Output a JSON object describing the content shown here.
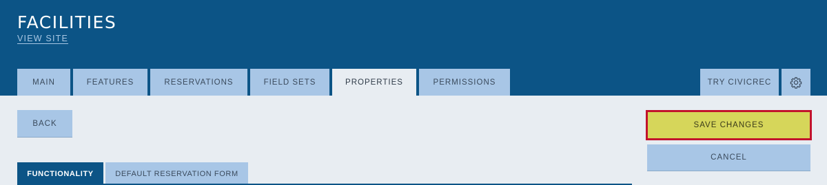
{
  "header": {
    "title": "FACILITIES",
    "view_site": "VIEW SITE"
  },
  "tabs": {
    "main": "MAIN",
    "features": "FEATURES",
    "reservations": "RESERVATIONS",
    "field_sets": "FIELD SETS",
    "properties": "PROPERTIES",
    "permissions": "PERMISSIONS",
    "active": "PROPERTIES"
  },
  "right_tabs": {
    "try_civicrec": "TRY CIVICREC",
    "settings_icon": "gear-icon"
  },
  "actions": {
    "back": "BACK",
    "save_changes": "SAVE CHANGES",
    "cancel": "CANCEL"
  },
  "subtabs": {
    "functionality": "FUNCTIONALITY",
    "default_reservation_form": "DEFAULT RESERVATION FORM",
    "active": "FUNCTIONALITY"
  },
  "colors": {
    "header_bg": "#0c5486",
    "tab_bg": "#a8c6e6",
    "page_bg": "#e8edf2",
    "save_bg": "#d6d65a",
    "save_border": "#c2122c"
  }
}
